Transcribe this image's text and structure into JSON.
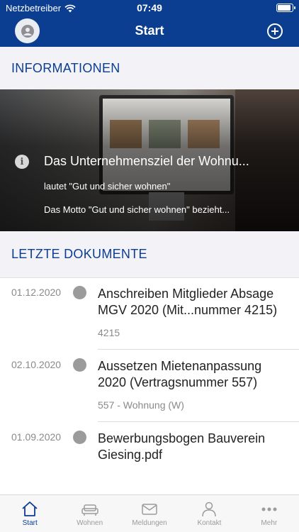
{
  "status": {
    "carrier": "Netzbetreiber",
    "time": "07:49",
    "battery_percent": 95
  },
  "nav": {
    "title": "Start"
  },
  "sections": {
    "info": "INFORMATIONEN",
    "docs": "LETZTE DOKUMENTE"
  },
  "banner": {
    "title": "Das Unternehmensziel der Wohnu...",
    "line1": "lautet \"Gut und sicher wohnen\"",
    "line2": "Das Motto \"Gut und sicher wohnen\" bezieht..."
  },
  "documents": [
    {
      "date": "01.12.2020",
      "title": "Anschreiben Mitglieder Absage MGV 2020 (Mit...nummer 4215)",
      "subtitle": "4215"
    },
    {
      "date": "02.10.2020",
      "title": "Aussetzen Mietenanpassung 2020 (Vertragsnummer 557)",
      "subtitle": "557 - Wohnung (W)"
    },
    {
      "date": "01.09.2020",
      "title": "Bewerbungsbogen Bauverein Giesing.pdf",
      "subtitle": ""
    }
  ],
  "tabs": [
    {
      "label": "Start",
      "icon": "home-icon",
      "active": true
    },
    {
      "label": "Wohnen",
      "icon": "sofa-icon",
      "active": false
    },
    {
      "label": "Meldungen",
      "icon": "envelope-icon",
      "active": false
    },
    {
      "label": "Kontakt",
      "icon": "person-icon",
      "active": false
    },
    {
      "label": "Mehr",
      "icon": "more-dots-icon",
      "active": false
    }
  ],
  "colors": {
    "brand": "#0b3d91",
    "section_bg": "#f2f2f7"
  }
}
